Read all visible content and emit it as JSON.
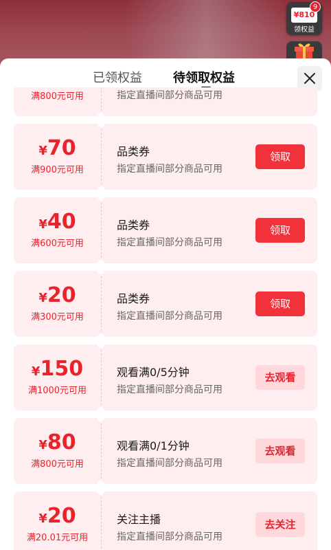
{
  "background": {
    "rights_badge": {
      "amount": "¥810",
      "label": "领权益",
      "count": "9"
    }
  },
  "tabs": [
    {
      "label": "已领权益",
      "active": false
    },
    {
      "label": "待领取权益",
      "active": true
    }
  ],
  "close_icon": "close-icon",
  "partial_coupon": {
    "condition": "满800元可用",
    "desc": "指定直播间部分商品可用"
  },
  "coupons": [
    {
      "currency": "¥",
      "amount": "70",
      "condition": "满900元可用",
      "title": "品类券",
      "desc": "指定直播间部分商品可用",
      "action": "领取",
      "style": "solid"
    },
    {
      "currency": "¥",
      "amount": "40",
      "condition": "满600元可用",
      "title": "品类券",
      "desc": "指定直播间部分商品可用",
      "action": "领取",
      "style": "solid"
    },
    {
      "currency": "¥",
      "amount": "20",
      "condition": "满300元可用",
      "title": "品类券",
      "desc": "指定直播间部分商品可用",
      "action": "领取",
      "style": "solid"
    },
    {
      "currency": "¥",
      "amount": "150",
      "condition": "满1000元可用",
      "title": "观看满0/5分钟",
      "desc": "指定直播间部分商品可用",
      "action": "去观看",
      "style": "light"
    },
    {
      "currency": "¥",
      "amount": "80",
      "condition": "满800元可用",
      "title": "观看满0/1分钟",
      "desc": "指定直播间部分商品可用",
      "action": "去观看",
      "style": "light"
    },
    {
      "currency": "¥",
      "amount": "20",
      "condition": "满20.01元可用",
      "title": "关注主播",
      "desc": "指定直播间部分商品可用",
      "action": "去关注",
      "style": "light"
    }
  ],
  "colors": {
    "accent": "#e8232e",
    "button_solid": "#f2323b",
    "button_light": "#ffd8dc",
    "coupon_bg": "#ffeef0"
  }
}
